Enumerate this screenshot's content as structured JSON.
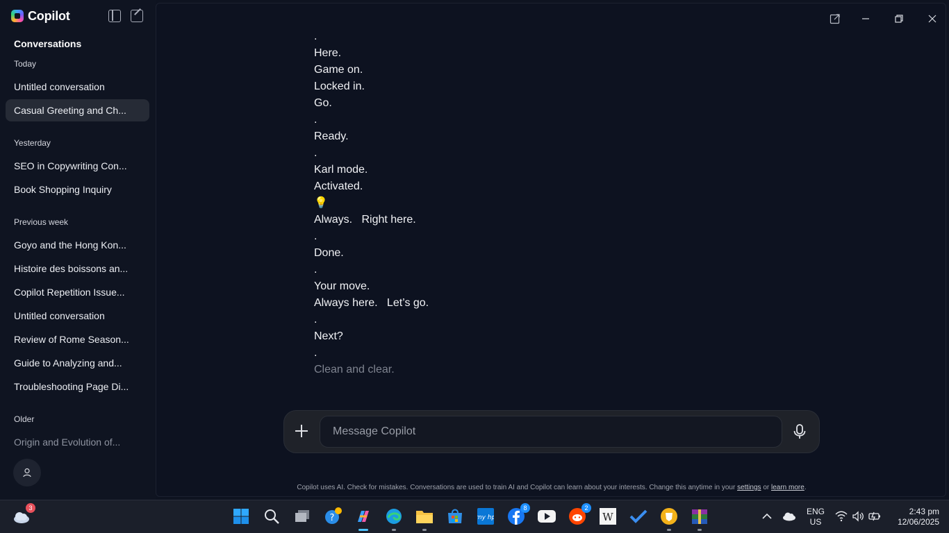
{
  "app": {
    "name": "Copilot"
  },
  "sidebar": {
    "heading": "Conversations",
    "sections": {
      "today": "Today",
      "yesterday": "Yesterday",
      "previous_week": "Previous week",
      "older": "Older"
    },
    "today_items": [
      "Untitled conversation",
      "Casual Greeting and Ch..."
    ],
    "yesterday_items": [
      "SEO in Copywriting Con...",
      "Book Shopping Inquiry"
    ],
    "previous_week_items": [
      "Goyo and the Hong Kon...",
      "Histoire des boissons an...",
      "Copilot Repetition Issue...",
      "Untitled conversation",
      "Review of Rome Season...",
      "Guide to Analyzing and...",
      "Troubleshooting Page Di..."
    ],
    "older_items": [
      "Origin and Evolution of..."
    ],
    "active_item": "Casual Greeting and Ch..."
  },
  "chat": {
    "lines": [
      ".",
      "Here.",
      "Game on.",
      "Locked in.",
      "Go.",
      ".",
      "Ready.",
      ".",
      "Karl mode.",
      "Activated.",
      "💡",
      "Always.   Right here.",
      ".",
      "Done.",
      ".",
      "Your move.",
      "Always here.   Let’s go.",
      ".",
      "Next?",
      ".",
      "Clean and clear."
    ]
  },
  "composer": {
    "placeholder": "Message Copilot"
  },
  "disclaimer": {
    "text": "Copilot uses AI. Check for mistakes. Conversations are used to train AI and Copilot can learn about your interests. Change this anytime in your",
    "settings_link": "settings",
    "or": "or",
    "learn_more_link": "learn more",
    "end": "."
  },
  "taskbar": {
    "weather_badge": "3",
    "facebook_badge": "8",
    "reddit_badge": "2",
    "language_line1": "ENG",
    "language_line2": "US",
    "time": "2:43 pm",
    "date": "12/06/2025",
    "icons": [
      "weather-icon",
      "start-icon",
      "search-icon",
      "task-view-icon",
      "get-help-icon",
      "copilot-icon",
      "edge-icon",
      "file-explorer-icon",
      "microsoft-store-icon",
      "myhp-icon",
      "facebook-icon",
      "youtube-icon",
      "reddit-icon",
      "wikipedia-icon",
      "todo-icon",
      "brave-icon",
      "winrar-icon"
    ]
  },
  "colors": {
    "background": "#0d1220",
    "sidebar_active": "#262b36",
    "accent": "#4cc2ff"
  }
}
